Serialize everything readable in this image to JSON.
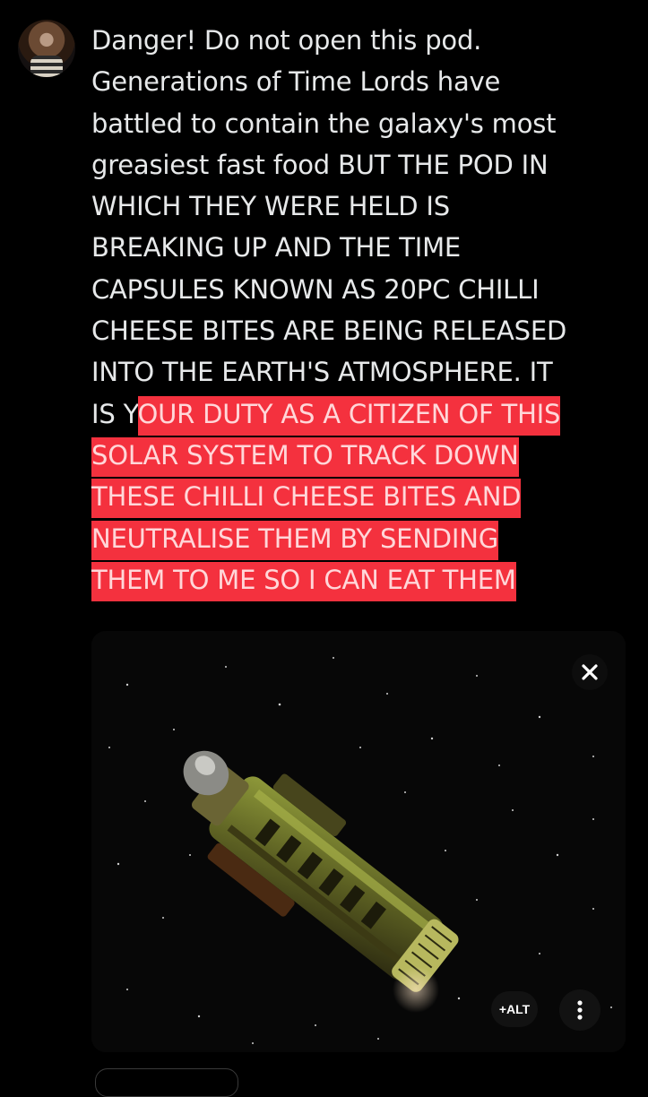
{
  "post": {
    "text_plain": "Danger! Do not open this pod.\nGenerations of Time Lords have\nbattled to contain the galaxy's most\ngreasiest fast food BUT THE POD IN\nWHICH THEY WERE HELD IS\nBREAKING UP AND THE TIME\nCAPSULES KNOWN AS 20PC CHILLI\nCHEESE BITES ARE BEING RELEASED\nINTO THE EARTH'S ATMOSPHERE. IT\nIS Y",
    "text_highlighted": "OUR DUTY AS A CITIZEN OF THIS\nSOLAR SYSTEM TO TRACK DOWN\nTHESE CHILLI CHEESE BITES AND\nNEUTRALISE THEM BY SENDING\nTHEM TO ME SO I CAN EAT THEM"
  },
  "media": {
    "alt_label": "+ALT"
  },
  "icons": {
    "close": "close-icon",
    "more": "more-vertical-icon",
    "avatar": "avatar"
  },
  "colors": {
    "background": "#000000",
    "text": "#e7e9ea",
    "highlight": "#f4313e"
  }
}
